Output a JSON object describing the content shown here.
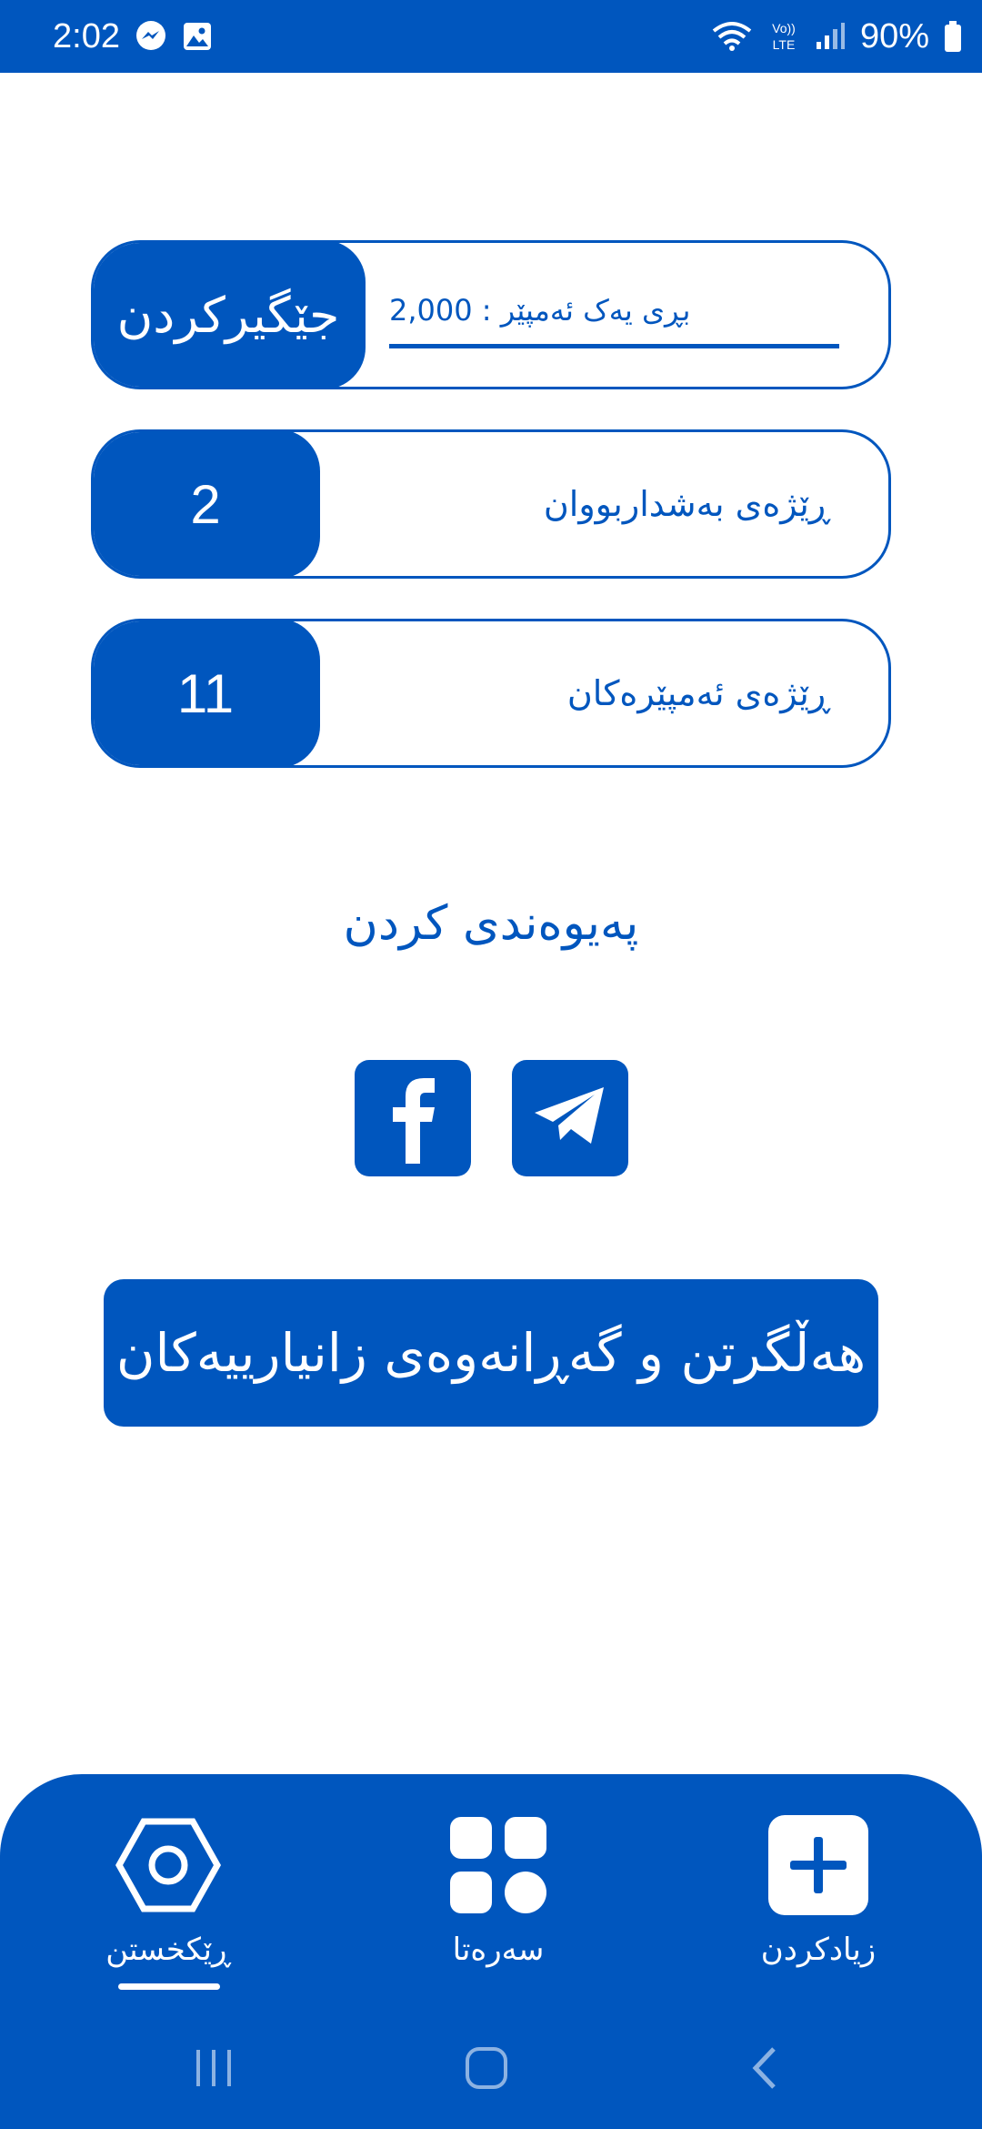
{
  "status_bar": {
    "time": "2:02",
    "battery": "90%",
    "left_icons": [
      "messenger-icon",
      "image-icon"
    ],
    "right_icons": [
      "wifi-icon",
      "volte-icon",
      "signal-icon",
      "battery-icon"
    ]
  },
  "settings": {
    "amount_field": {
      "value": "بڕی یەک ئەمپێر : 2,000"
    },
    "save_label": "جێگیرکردن",
    "subscribers": {
      "label": "ڕێژەی بەشداربووان",
      "count": "2"
    },
    "amperes": {
      "label": "ڕێژەی ئەمپێرەکان",
      "count": "11"
    }
  },
  "contact": {
    "title": "پەیوەندی کردن",
    "links": [
      {
        "icon": "facebook-icon"
      },
      {
        "icon": "telegram-icon"
      }
    ]
  },
  "backup_button": {
    "label": "هەڵگرتن و گەڕانەوەی زانیارییەکان"
  },
  "bottom_nav": {
    "items": [
      {
        "label": "ڕێکخستن",
        "icon": "settings-icon",
        "active": true
      },
      {
        "label": "سەرەتا",
        "icon": "grid-icon",
        "active": false
      },
      {
        "label": "زیادکردن",
        "icon": "plus-icon",
        "active": false
      }
    ]
  },
  "colors": {
    "primary": "#0056be",
    "background": "#ffffff",
    "on_primary": "#ffffff"
  }
}
